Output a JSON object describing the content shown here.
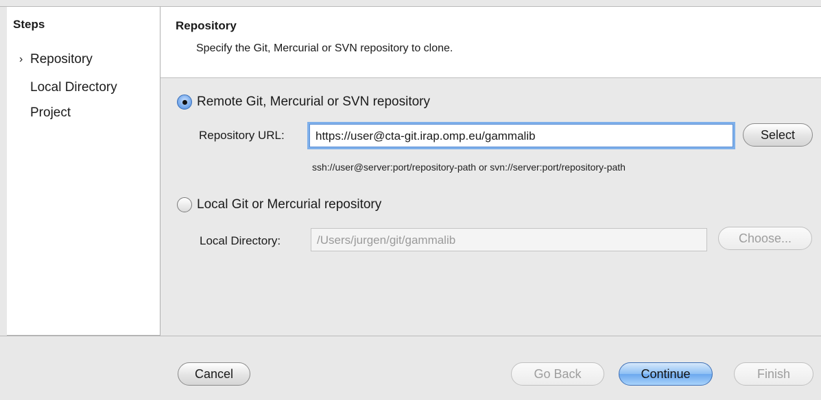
{
  "sidebar": {
    "title": "Steps",
    "current_marker": "›",
    "items": [
      {
        "label": "Repository"
      },
      {
        "label": "Local Directory"
      },
      {
        "label": "Project"
      }
    ]
  },
  "header": {
    "title": "Repository",
    "description": "Specify the Git, Mercurial or SVN repository to clone."
  },
  "remote": {
    "radio_label": "Remote Git, Mercurial or SVN repository",
    "selected": true,
    "url_label": "Repository URL:",
    "url_value": "https://user@cta-git.irap.omp.eu/gammalib",
    "select_label": "Select",
    "hint": "ssh://user@server:port/repository-path or svn://server:port/repository-path"
  },
  "local": {
    "radio_label": "Local Git or Mercurial repository",
    "selected": false,
    "dir_label": "Local Directory:",
    "dir_placeholder": "/Users/jurgen/git/gammalib",
    "choose_label": "Choose..."
  },
  "footer": {
    "cancel_label": "Cancel",
    "back_label": "Go Back",
    "continue_label": "Continue",
    "finish_label": "Finish"
  }
}
